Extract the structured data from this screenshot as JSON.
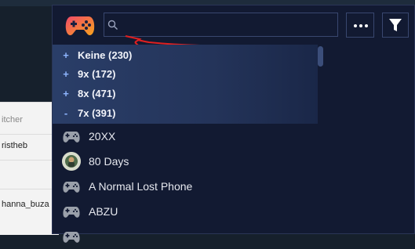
{
  "background_app": {
    "search_hint": "itcher",
    "user_1": "ristheb",
    "user_2": "hanna_buza"
  },
  "search": {
    "value": "",
    "placeholder": ""
  },
  "groups": [
    {
      "sign": "+",
      "label": "Keine (230)"
    },
    {
      "sign": "+",
      "label": "9x (172)"
    },
    {
      "sign": "+",
      "label": "8x (471)"
    },
    {
      "sign": "-",
      "label": "7x (391)"
    }
  ],
  "games": [
    {
      "name": "20XX",
      "icon": "controller-icon"
    },
    {
      "name": "80 Days",
      "icon": "game-avatar"
    },
    {
      "name": "A Normal Lost Phone",
      "icon": "controller-icon"
    },
    {
      "name": "ABZU",
      "icon": "controller-icon"
    },
    {
      "name": "",
      "icon": "controller-icon"
    }
  ],
  "colors": {
    "accent_blue": "#8fb6ff",
    "annotation_red": "#e02020",
    "logo_gradient": [
      "#f04a6a",
      "#f7a31c"
    ]
  }
}
